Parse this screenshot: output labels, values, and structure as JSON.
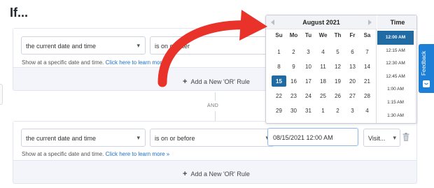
{
  "page": {
    "title": "If..."
  },
  "rule1": {
    "condition": "the current date and time",
    "operator": "is on or after",
    "help_text": "Show at a specific date and time.",
    "help_link": "Click here to learn more »",
    "add_or_label": "Add a New 'OR' Rule"
  },
  "and_label": "AND",
  "rule2": {
    "condition": "the current date and time",
    "operator": "is on or before",
    "date_value": "08/15/2021 12:00 AM",
    "visitor_select": "Visit...",
    "help_text": "Show at a specific date and time.",
    "help_link": "Click here to learn more »",
    "add_or_label": "Add a New 'OR' Rule"
  },
  "datepicker": {
    "month_title": "August 2021",
    "day_names": [
      "Su",
      "Mo",
      "Tu",
      "We",
      "Th",
      "Fr",
      "Sa"
    ],
    "weeks": [
      [
        "1",
        "2",
        "3",
        "4",
        "5",
        "6",
        "7"
      ],
      [
        "8",
        "9",
        "10",
        "11",
        "12",
        "13",
        "14"
      ],
      [
        "15",
        "16",
        "17",
        "18",
        "19",
        "20",
        "21"
      ],
      [
        "22",
        "23",
        "24",
        "25",
        "26",
        "27",
        "28"
      ],
      [
        "29",
        "30",
        "31",
        "1",
        "2",
        "3",
        "4"
      ]
    ],
    "selected_day": "15",
    "time_header": "Time",
    "times": [
      "12:00 AM",
      "12:15 AM",
      "12:30 AM",
      "12:45 AM",
      "1:00 AM",
      "1:15 AM",
      "1:30 AM"
    ],
    "selected_time": "12:00 AM"
  },
  "feedback_label": "Feedback",
  "colors": {
    "accent": "#216ba5",
    "link": "#1c6fc9",
    "annotation_arrow": "#e8322a",
    "feedback_tab": "#1e7fd6"
  }
}
